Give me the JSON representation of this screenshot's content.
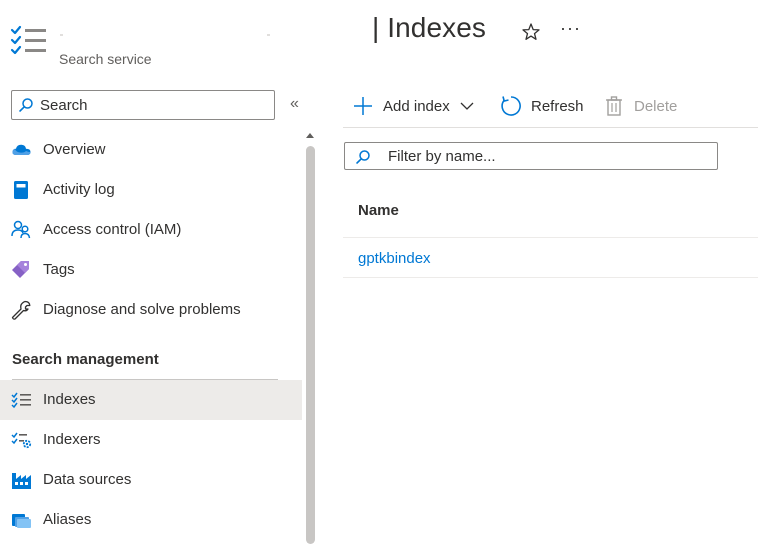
{
  "header": {
    "service_subtitle": "Search service",
    "page_title": "| Indexes",
    "more_label": "···",
    "icons": {
      "service": "search-index-list-icon",
      "favorite": "star-icon"
    }
  },
  "sidebar": {
    "search_placeholder": "Search",
    "collapse_label": "«",
    "items": [
      {
        "label": "Overview",
        "icon": "cloud-overview-icon"
      },
      {
        "label": "Activity log",
        "icon": "activity-log-icon"
      },
      {
        "label": "Access control (IAM)",
        "icon": "people-iam-icon"
      },
      {
        "label": "Tags",
        "icon": "tag-icon"
      },
      {
        "label": "Diagnose and solve problems",
        "icon": "wrench-icon"
      }
    ],
    "section_title": "Search management",
    "section_items": [
      {
        "label": "Indexes",
        "icon": "index-list-icon",
        "active": true
      },
      {
        "label": "Indexers",
        "icon": "indexer-gear-icon",
        "active": false
      },
      {
        "label": "Data sources",
        "icon": "data-sources-icon",
        "active": false
      },
      {
        "label": "Aliases",
        "icon": "aliases-icon",
        "active": false
      }
    ]
  },
  "toolbar": {
    "add_label": "Add index",
    "refresh_label": "Refresh",
    "delete_label": "Delete"
  },
  "main": {
    "filter_placeholder": "Filter by name...",
    "column_name": "Name",
    "rows": [
      "gptkbindex"
    ]
  },
  "colors": {
    "accent": "#0078d4",
    "active_bg": "#edebe9",
    "disabled_text": "#a19f9d"
  }
}
